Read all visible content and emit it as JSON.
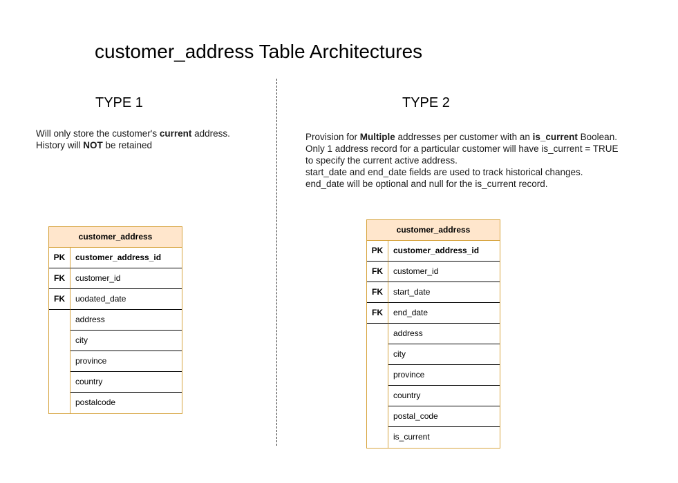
{
  "title": "customer_address Table Architectures",
  "type1": {
    "heading": "TYPE 1",
    "description": [
      [
        {
          "t": "Will only store the customer's ",
          "b": false
        },
        {
          "t": "current",
          "b": true
        },
        {
          "t": " address.",
          "b": false
        }
      ],
      [
        {
          "t": "History will ",
          "b": false
        },
        {
          "t": "NOT",
          "b": true
        },
        {
          "t": " be retained",
          "b": false
        }
      ]
    ],
    "table": {
      "name": "customer_address",
      "rows": [
        {
          "key": "PK",
          "field": "customer_address_id"
        },
        {
          "key": "FK",
          "field": "customer_id"
        },
        {
          "key": "FK",
          "field": "uodated_date"
        },
        {
          "key": "",
          "field": "address"
        },
        {
          "key": "",
          "field": "city"
        },
        {
          "key": "",
          "field": "province"
        },
        {
          "key": "",
          "field": "country"
        },
        {
          "key": "",
          "field": "postalcode"
        }
      ]
    }
  },
  "type2": {
    "heading": "TYPE 2",
    "description": [
      [
        {
          "t": "Provision for ",
          "b": false
        },
        {
          "t": "Multiple",
          "b": true
        },
        {
          "t": " addresses per customer with an ",
          "b": false
        },
        {
          "t": "is_current",
          "b": true
        },
        {
          "t": " Boolean.",
          "b": false
        }
      ],
      [
        {
          "t": "Only 1 address record for a particular customer will have is_current = TRUE",
          "b": false
        }
      ],
      [
        {
          "t": "to specify the current active address.",
          "b": false
        }
      ],
      [
        {
          "t": "start_date and end_date fields are used to track historical changes.",
          "b": false
        }
      ],
      [
        {
          "t": "end_date will be optional and null for the is_current record.",
          "b": false
        }
      ]
    ],
    "table": {
      "name": "customer_address",
      "rows": [
        {
          "key": "PK",
          "field": "customer_address_id"
        },
        {
          "key": "FK",
          "field": "customer_id"
        },
        {
          "key": "FK",
          "field": "start_date"
        },
        {
          "key": "FK",
          "field": "end_date"
        },
        {
          "key": "",
          "field": "address"
        },
        {
          "key": "",
          "field": "city"
        },
        {
          "key": "",
          "field": "province"
        },
        {
          "key": "",
          "field": "country"
        },
        {
          "key": "",
          "field": "postal_code"
        },
        {
          "key": "",
          "field": "is_current"
        }
      ]
    }
  },
  "colors": {
    "table_header_bg": "#ffe6cc",
    "table_border": "#d6a23b"
  }
}
